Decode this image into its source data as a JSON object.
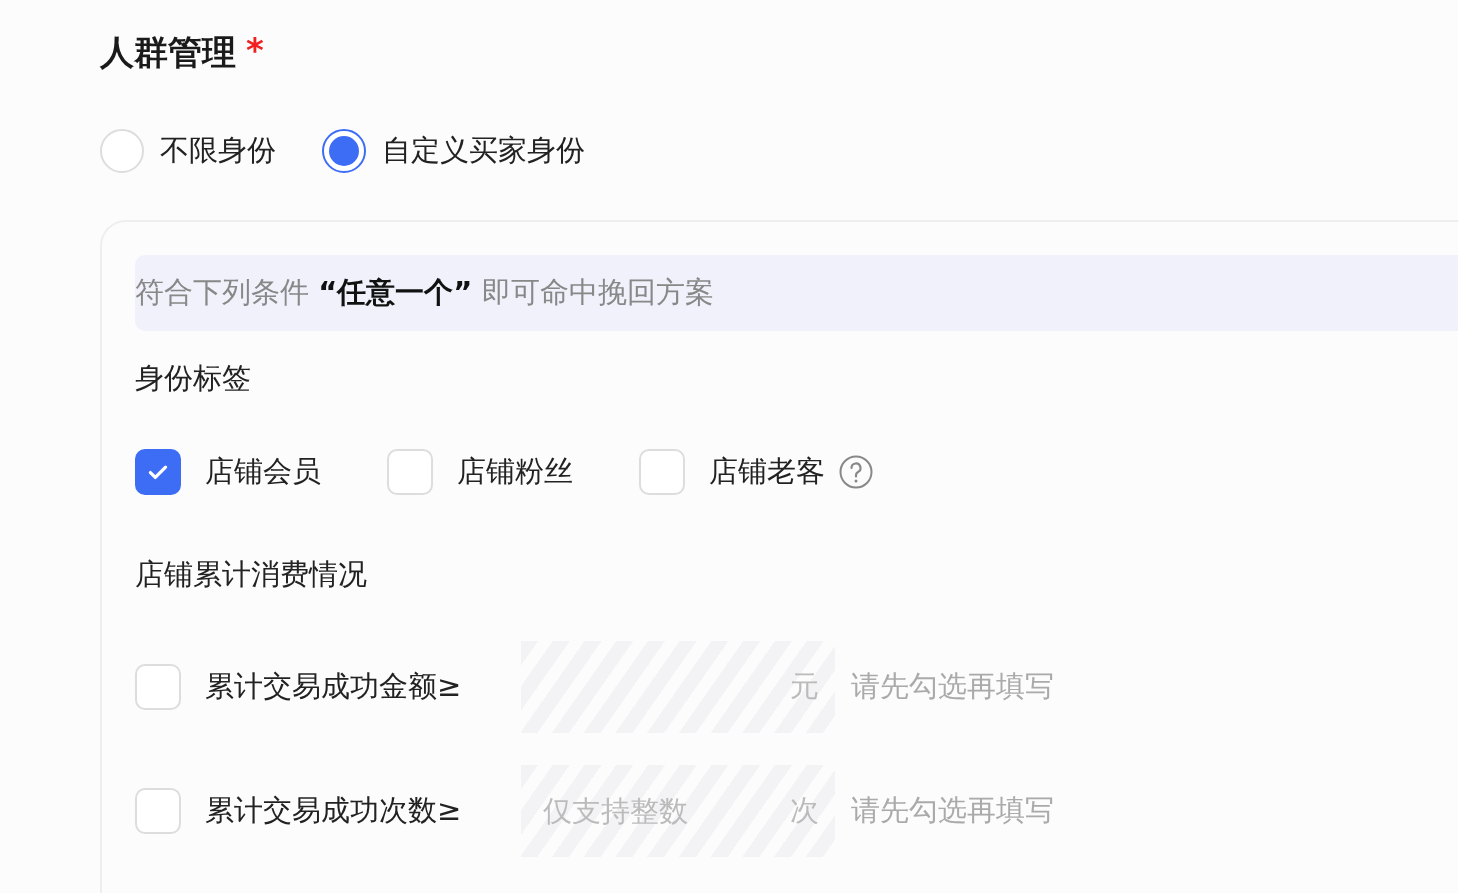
{
  "section": {
    "title": "人群管理",
    "required_mark": "*"
  },
  "radios": [
    {
      "label": "不限身份",
      "selected": false
    },
    {
      "label": "自定义买家身份",
      "selected": true
    }
  ],
  "panel": {
    "banner": "符合下列条件 **“任意一个”** 即可命中挽回方案",
    "identity": {
      "heading": "身份标签",
      "options": [
        {
          "label": "店铺会员",
          "checked": true
        },
        {
          "label": "店铺粉丝",
          "checked": false
        },
        {
          "label": "店铺老客",
          "checked": false,
          "help": true
        }
      ]
    },
    "spending": {
      "heading": "店铺累计消费情况",
      "rows": [
        {
          "label": "累计交易成功金额≥",
          "checked": false,
          "disabled": true,
          "unit": "元",
          "hint": "请先勾选再填写"
        },
        {
          "label": "累计交易成功次数≥",
          "checked": false,
          "disabled": true,
          "placeholder": "仅支持整数",
          "unit": "次",
          "hint": "请先勾选再填写"
        }
      ]
    }
  }
}
